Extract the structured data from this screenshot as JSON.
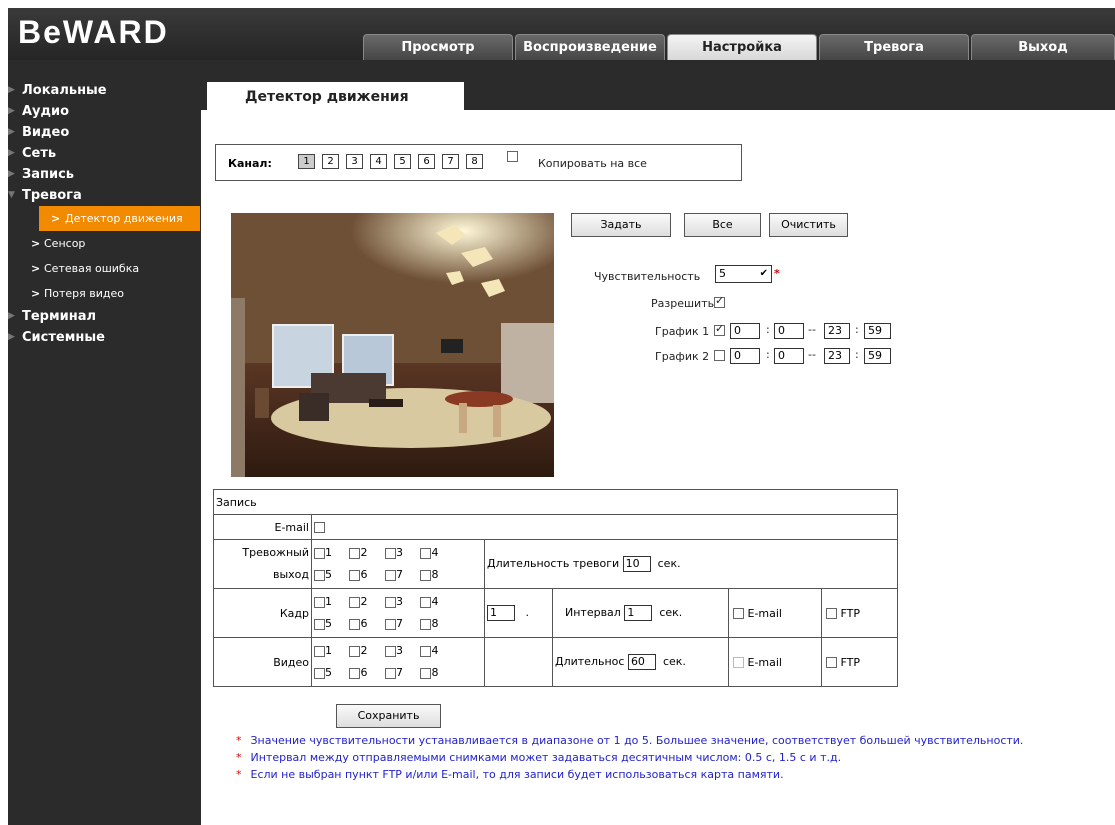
{
  "brand": {
    "logo": "BeWARD"
  },
  "tabs": [
    "Просмотр",
    "Воспроизведение",
    "Настройка",
    "Тревога",
    "Выход"
  ],
  "sidebar": {
    "items": [
      "Локальные",
      "Аудио",
      "Видео",
      "Сеть",
      "Запись",
      "Тревога"
    ],
    "sub": [
      "Детектор движения",
      "Сенсор",
      "Сетевая ошибка",
      "Потеря видео"
    ],
    "items2": [
      "Терминал",
      "Системные"
    ]
  },
  "page": {
    "title": "Детектор движения"
  },
  "channel": {
    "label": "Канал:",
    "numbers": [
      "1",
      "2",
      "3",
      "4",
      "5",
      "6",
      "7",
      "8"
    ],
    "selected": "1",
    "copy_all": "Копировать на все"
  },
  "actions": {
    "set": "Задать",
    "all": "Все",
    "clear": "Очистить",
    "save": "Сохранить"
  },
  "settings": {
    "sensitivity_label": "Чувствительность",
    "sensitivity_value": "5",
    "required_mark": "*",
    "enable_label": "Разрешить",
    "enable_checked": true,
    "schedule1": {
      "label": "График 1",
      "checked": true,
      "start_h": "0",
      "start_m": "0",
      "end_h": "23",
      "end_m": "59"
    },
    "schedule2": {
      "label": "График 2",
      "checked": false,
      "start_h": "0",
      "start_m": "0",
      "end_h": "23",
      "end_m": "59"
    }
  },
  "record": {
    "header": "Запись",
    "email_label": "E-mail",
    "alarm_label1": "Тревожный",
    "alarm_label2": "выход",
    "duration_label": "Длительность тревоги",
    "duration_value": "10",
    "sec": "сек.",
    "frame_label": "Кадр",
    "frame_count": "1",
    "dot": ".",
    "interval_label": "Интервал",
    "interval_value": "1",
    "video_label": "Видео",
    "video_duration_label": "Длительнос",
    "video_duration_value": "60",
    "ftp": "FTP",
    "email": "E-mail",
    "outputs": [
      "1",
      "2",
      "3",
      "4",
      "5",
      "6",
      "7",
      "8"
    ]
  },
  "notes": [
    "Значение чувствительности устанавливается в диапазоне от 1 до 5. Большее значение, соответствует большей чувствительности.",
    "Интервал между отправляемыми снимками может задаваться десятичным числом: 0.5 с, 1.5 с и т.д.",
    "Если не выбран пункт FTP и/или E-mail, то для записи будет использоваться карта памяти."
  ],
  "colors": {
    "accent": "#f28a00",
    "note_text": "#2222cc",
    "star": "#dd0000"
  }
}
